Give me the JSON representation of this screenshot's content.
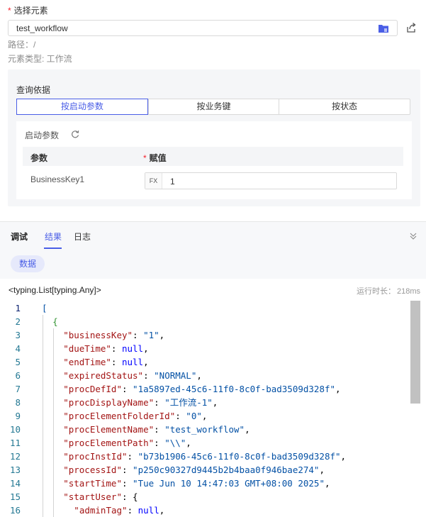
{
  "select_element": {
    "label": "选择元素",
    "required_mark": "*",
    "value": "test_workflow",
    "folder_icon": "folder-icon",
    "share_icon": "external-link-icon"
  },
  "meta": {
    "path": "路径：/",
    "element_type": "元素类型: 工作流"
  },
  "query": {
    "title": "查询依据",
    "options": [
      "按启动参数",
      "按业务键",
      "按状态"
    ],
    "active_index": 0,
    "params_title": "启动参数",
    "refresh_icon": "refresh-icon",
    "col_param": "参数",
    "col_value": "赋值",
    "required_mark": "*",
    "rows": [
      {
        "name": "BusinessKey1",
        "fx": "FX",
        "value": "1"
      }
    ]
  },
  "bottom_tabs": {
    "tabs": [
      "调试",
      "结果",
      "日志"
    ],
    "active": "结果",
    "collapse_icon": "chevron-double-down-icon"
  },
  "result": {
    "data_pill": "数据",
    "type": "<typing.List[typing.Any]>",
    "runtime_label": "运行时长：",
    "runtime_value": "218ms"
  },
  "code": {
    "lines": [
      {
        "n": "1",
        "indent": 0,
        "text": "["
      },
      {
        "n": "2",
        "indent": 1,
        "text": "{"
      },
      {
        "n": "3",
        "indent": 2,
        "key": "\"businessKey\"",
        "val": "\"1\"",
        "vtype": "s",
        "comma": ","
      },
      {
        "n": "4",
        "indent": 2,
        "key": "\"dueTime\"",
        "val": "null",
        "vtype": "kw",
        "comma": ","
      },
      {
        "n": "5",
        "indent": 2,
        "key": "\"endTime\"",
        "val": "null",
        "vtype": "kw",
        "comma": ","
      },
      {
        "n": "6",
        "indent": 2,
        "key": "\"expiredStatus\"",
        "val": "\"NORMAL\"",
        "vtype": "s",
        "comma": ","
      },
      {
        "n": "7",
        "indent": 2,
        "key": "\"procDefId\"",
        "val": "\"1a5897ed-45c6-11f0-8c0f-bad3509d328f\"",
        "vtype": "s",
        "comma": ","
      },
      {
        "n": "8",
        "indent": 2,
        "key": "\"procDisplayName\"",
        "val": "\"工作流-1\"",
        "vtype": "s",
        "comma": ","
      },
      {
        "n": "9",
        "indent": 2,
        "key": "\"procElementFolderId\"",
        "val": "\"0\"",
        "vtype": "s",
        "comma": ","
      },
      {
        "n": "10",
        "indent": 2,
        "key": "\"procElementName\"",
        "val": "\"test_workflow\"",
        "vtype": "s",
        "comma": ","
      },
      {
        "n": "11",
        "indent": 2,
        "key": "\"procElementPath\"",
        "val": "\"\\\\\"",
        "vtype": "s",
        "comma": ","
      },
      {
        "n": "12",
        "indent": 2,
        "key": "\"procInstId\"",
        "val": "\"b73b1906-45c6-11f0-8c0f-bad3509d328f\"",
        "vtype": "s",
        "comma": ","
      },
      {
        "n": "13",
        "indent": 2,
        "key": "\"processId\"",
        "val": "\"p250c90327d9445b2b4baa0f946bae274\"",
        "vtype": "s",
        "comma": ","
      },
      {
        "n": "14",
        "indent": 2,
        "key": "\"startTime\"",
        "val": "\"Tue Jun 10 14:47:03 GMT+08:00 2025\"",
        "vtype": "s",
        "comma": ","
      },
      {
        "n": "15",
        "indent": 2,
        "key": "\"startUser\"",
        "val": "{",
        "vtype": "p",
        "comma": ""
      },
      {
        "n": "16",
        "indent": 3,
        "key": "\"adminTag\"",
        "val": "null",
        "vtype": "kw",
        "comma": ","
      }
    ],
    "current_line": "1",
    "colors": {
      "key": "#a31515",
      "string": "#0451a5",
      "keyword": "#0000ff",
      "line_number": "#237893"
    }
  }
}
